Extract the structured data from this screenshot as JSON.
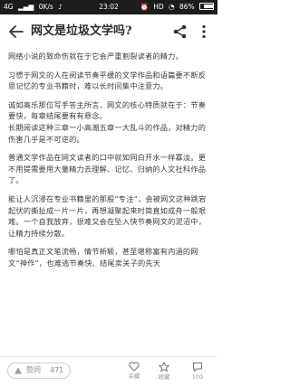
{
  "status_bar": {
    "network": "4G",
    "speed": "0K/s",
    "time": "23:02",
    "hd": "HD",
    "battery": "86%",
    "battery_level": 0.86
  },
  "header": {
    "title": "网文是垃圾文学吗?"
  },
  "article": {
    "paragraphs": [
      "网络小说的致命伤就在于它会严重割裂读者的精力。",
      "习惯于网文的人在阅读节奏平缓的文学作品和语篇要不断反思记忆的专业书籍时，难以长时间集中注意力。",
      "诚如高乐那位写手答主所言，网文的核心特质就在于：节奏要快，每章结尾要有有悬念。",
      "长期阅读这种三章一小高潮五章一大乱斗的作品，对精力的伤害几乎是不可逆的。",
      "普通文学作品在网文读者的口中就如同白开水一样寡淡。更不用提需要用大量精力去理解、记忆、归纳的人文社科作品了。",
      "能让人沉浸在专业书籍里的那股“专注”，会被网文这种跳宕起伏的撕扯成一片一片，再想凝聚起来时简直如成舟一般艰难。一个自我放弃，很难又会在坠入快节奏网文的泥沼中，让精力持续分散。",
      "哪怕是真正文笔流畅，情节新颖，甚至堪称富有内涵的网文“神作”，也难逃节奏快、结尾卖关子的先天"
    ]
  },
  "bottom_bar": {
    "vote_label": "赞同",
    "vote_count": "471",
    "disable_label": "杀藏",
    "favorite_label": "收藏",
    "comment_count": "100"
  }
}
